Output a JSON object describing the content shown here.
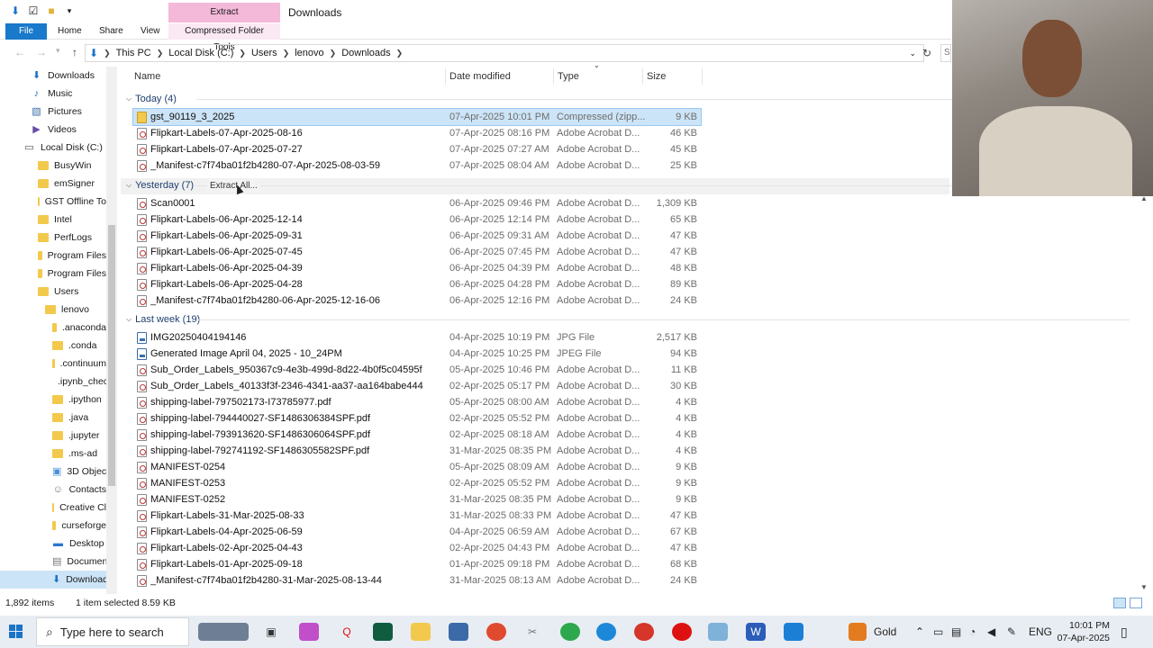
{
  "window": {
    "title": "Downloads",
    "context_tab_group": "Extract",
    "qat": [
      "down-arrow-icon",
      "properties-icon",
      "folder-icon",
      "customize-icon"
    ]
  },
  "ribbon": {
    "tabs": [
      {
        "label": "File"
      },
      {
        "label": "Home"
      },
      {
        "label": "Share"
      },
      {
        "label": "View"
      },
      {
        "label": "Compressed Folder Tools"
      }
    ]
  },
  "address": {
    "crumbs": [
      "This PC",
      "Local Disk (C:)",
      "Users",
      "lenovo",
      "Downloads"
    ],
    "search_placeholder": "S"
  },
  "nav": {
    "items": [
      {
        "label": "Downloads",
        "icon": "download-icon"
      },
      {
        "label": "Music",
        "icon": "music-icon"
      },
      {
        "label": "Pictures",
        "icon": "pictures-icon"
      },
      {
        "label": "Videos",
        "icon": "videos-icon"
      },
      {
        "label": "Local Disk (C:)",
        "icon": "drive-icon"
      },
      {
        "label": "BusyWin",
        "icon": "folder-icon"
      },
      {
        "label": "emSigner",
        "icon": "folder-icon"
      },
      {
        "label": "GST Offline To",
        "icon": "folder-icon"
      },
      {
        "label": "Intel",
        "icon": "folder-icon"
      },
      {
        "label": "PerfLogs",
        "icon": "folder-icon"
      },
      {
        "label": "Program Files",
        "icon": "folder-icon"
      },
      {
        "label": "Program Files",
        "icon": "folder-icon"
      },
      {
        "label": "Users",
        "icon": "folder-icon"
      },
      {
        "label": "lenovo",
        "icon": "folder-icon"
      },
      {
        "label": ".anaconda",
        "icon": "folder-icon"
      },
      {
        "label": ".conda",
        "icon": "folder-icon"
      },
      {
        "label": ".continuum",
        "icon": "folder-icon"
      },
      {
        "label": ".ipynb_chec",
        "icon": "folder-icon"
      },
      {
        "label": ".ipython",
        "icon": "folder-icon"
      },
      {
        "label": ".java",
        "icon": "folder-icon"
      },
      {
        "label": ".jupyter",
        "icon": "folder-icon"
      },
      {
        "label": ".ms-ad",
        "icon": "folder-icon"
      },
      {
        "label": "3D Objects",
        "icon": "3d-objects-icon"
      },
      {
        "label": "Contacts",
        "icon": "contacts-icon"
      },
      {
        "label": "Creative Cl",
        "icon": "folder-icon"
      },
      {
        "label": "curseforge",
        "icon": "folder-icon"
      },
      {
        "label": "Desktop",
        "icon": "desktop-icon"
      },
      {
        "label": "Documents",
        "icon": "documents-icon"
      },
      {
        "label": "Downloads",
        "icon": "download-icon"
      }
    ]
  },
  "columns": {
    "name": "Name",
    "date": "Date modified",
    "type": "Type",
    "size": "Size"
  },
  "groups": [
    {
      "label": "Today (4)",
      "rows": [
        {
          "name": "gst_90119_3_2025",
          "date": "07-Apr-2025 10:01 PM",
          "type": "Compressed (zipp...",
          "size": "9 KB",
          "icon": "zip",
          "selected": true
        },
        {
          "name": "Flipkart-Labels-07-Apr-2025-08-16",
          "date": "07-Apr-2025 08:16 PM",
          "type": "Adobe Acrobat D...",
          "size": "46 KB",
          "icon": "pdf"
        },
        {
          "name": "Flipkart-Labels-07-Apr-2025-07-27",
          "date": "07-Apr-2025 07:27 AM",
          "type": "Adobe Acrobat D...",
          "size": "45 KB",
          "icon": "pdf"
        },
        {
          "name": "_Manifest-c7f74ba01f2b4280-07-Apr-2025-08-03-59",
          "date": "07-Apr-2025 08:04 AM",
          "type": "Adobe Acrobat D...",
          "size": "25 KB",
          "icon": "pdf"
        }
      ]
    },
    {
      "label": "Yesterday (7)",
      "rows": [
        {
          "name": "Scan0001",
          "date": "06-Apr-2025 09:46 PM",
          "type": "Adobe Acrobat D...",
          "size": "1,309 KB",
          "icon": "pdf"
        },
        {
          "name": "Flipkart-Labels-06-Apr-2025-12-14",
          "date": "06-Apr-2025 12:14 PM",
          "type": "Adobe Acrobat D...",
          "size": "65 KB",
          "icon": "pdf"
        },
        {
          "name": "Flipkart-Labels-06-Apr-2025-09-31",
          "date": "06-Apr-2025 09:31 AM",
          "type": "Adobe Acrobat D...",
          "size": "47 KB",
          "icon": "pdf"
        },
        {
          "name": "Flipkart-Labels-06-Apr-2025-07-45",
          "date": "06-Apr-2025 07:45 PM",
          "type": "Adobe Acrobat D...",
          "size": "47 KB",
          "icon": "pdf"
        },
        {
          "name": "Flipkart-Labels-06-Apr-2025-04-39",
          "date": "06-Apr-2025 04:39 PM",
          "type": "Adobe Acrobat D...",
          "size": "48 KB",
          "icon": "pdf"
        },
        {
          "name": "Flipkart-Labels-06-Apr-2025-04-28",
          "date": "06-Apr-2025 04:28 PM",
          "type": "Adobe Acrobat D...",
          "size": "89 KB",
          "icon": "pdf"
        },
        {
          "name": "_Manifest-c7f74ba01f2b4280-06-Apr-2025-12-16-06",
          "date": "06-Apr-2025 12:16 PM",
          "type": "Adobe Acrobat D...",
          "size": "24 KB",
          "icon": "pdf"
        }
      ]
    },
    {
      "label": "Last week (19)",
      "rows": [
        {
          "name": "IMG20250404194146",
          "date": "04-Apr-2025 10:19 PM",
          "type": "JPG File",
          "size": "2,517 KB",
          "icon": "jpg"
        },
        {
          "name": "Generated Image April 04, 2025 - 10_24PM",
          "date": "04-Apr-2025 10:25 PM",
          "type": "JPEG File",
          "size": "94 KB",
          "icon": "jpg"
        },
        {
          "name": "Sub_Order_Labels_950367c9-4e3b-499d-8d22-4b0f5c04595f",
          "date": "05-Apr-2025 10:46 PM",
          "type": "Adobe Acrobat D...",
          "size": "11 KB",
          "icon": "pdf"
        },
        {
          "name": "Sub_Order_Labels_40133f3f-2346-4341-aa37-aa164babe444",
          "date": "02-Apr-2025 05:17 PM",
          "type": "Adobe Acrobat D...",
          "size": "30 KB",
          "icon": "pdf"
        },
        {
          "name": "shipping-label-797502173-I73785977.pdf",
          "date": "05-Apr-2025 08:00 AM",
          "type": "Adobe Acrobat D...",
          "size": "4 KB",
          "icon": "pdf"
        },
        {
          "name": "shipping-label-794440027-SF1486306384SPF.pdf",
          "date": "02-Apr-2025 05:52 PM",
          "type": "Adobe Acrobat D...",
          "size": "4 KB",
          "icon": "pdf"
        },
        {
          "name": "shipping-label-793913620-SF1486306064SPF.pdf",
          "date": "02-Apr-2025 08:18 AM",
          "type": "Adobe Acrobat D...",
          "size": "4 KB",
          "icon": "pdf"
        },
        {
          "name": "shipping-label-792741192-SF1486305582SPF.pdf",
          "date": "31-Mar-2025 08:35 PM",
          "type": "Adobe Acrobat D...",
          "size": "4 KB",
          "icon": "pdf"
        },
        {
          "name": "MANIFEST-0254",
          "date": "05-Apr-2025 08:09 AM",
          "type": "Adobe Acrobat D...",
          "size": "9 KB",
          "icon": "pdf"
        },
        {
          "name": "MANIFEST-0253",
          "date": "02-Apr-2025 05:52 PM",
          "type": "Adobe Acrobat D...",
          "size": "9 KB",
          "icon": "pdf"
        },
        {
          "name": "MANIFEST-0252",
          "date": "31-Mar-2025 08:35 PM",
          "type": "Adobe Acrobat D...",
          "size": "9 KB",
          "icon": "pdf"
        },
        {
          "name": "Flipkart-Labels-31-Mar-2025-08-33",
          "date": "31-Mar-2025 08:33 PM",
          "type": "Adobe Acrobat D...",
          "size": "47 KB",
          "icon": "pdf"
        },
        {
          "name": "Flipkart-Labels-04-Apr-2025-06-59",
          "date": "04-Apr-2025 06:59 AM",
          "type": "Adobe Acrobat D...",
          "size": "67 KB",
          "icon": "pdf"
        },
        {
          "name": "Flipkart-Labels-02-Apr-2025-04-43",
          "date": "02-Apr-2025 04:43 PM",
          "type": "Adobe Acrobat D...",
          "size": "47 KB",
          "icon": "pdf"
        },
        {
          "name": "Flipkart-Labels-01-Apr-2025-09-18",
          "date": "01-Apr-2025 09:18 PM",
          "type": "Adobe Acrobat D...",
          "size": "68 KB",
          "icon": "pdf"
        },
        {
          "name": "_Manifest-c7f74ba01f2b4280-31-Mar-2025-08-13-44",
          "date": "31-Mar-2025 08:13 AM",
          "type": "Adobe Acrobat D...",
          "size": "24 KB",
          "icon": "pdf"
        }
      ]
    }
  ],
  "hover_command": "Extract All...",
  "status": {
    "count": "1,892 items",
    "selection": "1 item selected  8.59 KB"
  },
  "taskbar": {
    "search_placeholder": "Type here to search",
    "weather": "Gold",
    "language": "ENG",
    "time": "10:01 PM",
    "date": "07-Apr-2025",
    "accent": "#1a73c7"
  }
}
